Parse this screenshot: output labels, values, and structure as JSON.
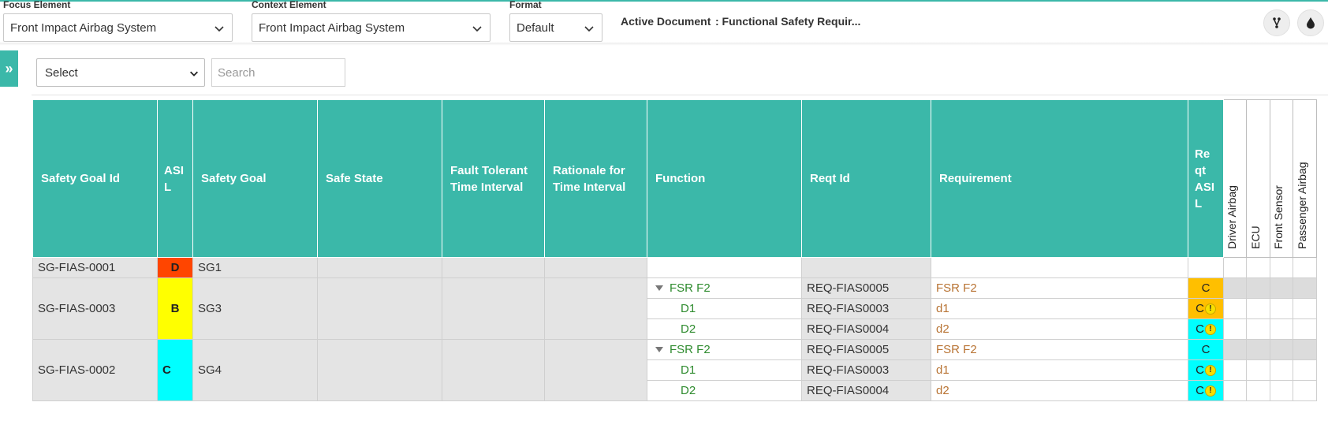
{
  "header": {
    "focus_label": "Focus Element",
    "focus_value": "Front Impact Airbag System",
    "context_label": "Context Element",
    "context_value": "Front Impact Airbag System",
    "format_label": "Format",
    "format_value": "Default",
    "active_doc_label": "Active Document",
    "active_doc_value": ": Functional Safety Requir..."
  },
  "toolbar": {
    "filter_select_value": "Select",
    "search_placeholder": "Search",
    "sidebar_toggle_glyph": "»"
  },
  "icons": {
    "left_button": "branch-icon",
    "right_button": "drop-icon",
    "sidebar_toggle": "double-chevron-right-icon",
    "row_expand": "triangle-down-icon",
    "warning": "warning-icon"
  },
  "colors": {
    "accent": "#3bb8a9",
    "asil_D": "#ff4500",
    "asil_B": "#ffff00",
    "asil_C": "#00ffff",
    "reqt_asil_orange": "#ffbf00",
    "function_text": "#2e8b2e",
    "requirement_text": "#b87333"
  },
  "table": {
    "columns": {
      "safety_goal_id": "Safety Goal Id",
      "asil": "ASI L",
      "safety_goal": "Safety Goal",
      "safe_state": "Safe State",
      "ftti": "Fault Tolerant Time Interval",
      "rationale": "Rationale for Time Interval",
      "function": "Function",
      "reqt_id": "Reqt Id",
      "requirement": "Requirement",
      "reqt_asil": "Re qt ASI L",
      "driver_airbag": "Driver Airbag",
      "ecu": "ECU",
      "front_sensor": "Front Sensor",
      "passenger_airbag": "Passenger Airbag"
    },
    "goals": [
      {
        "id": "SG-FIAS-0001",
        "asil": "D",
        "goal": "SG1"
      },
      {
        "id": "SG-FIAS-0003",
        "asil": "B",
        "goal": "SG3",
        "rows": [
          {
            "function": "FSR F2",
            "reqt_id": "REQ-FIAS0005",
            "requirement": "FSR F2",
            "reqt_asil": "C"
          },
          {
            "function": "D1",
            "reqt_id": "REQ-FIAS0003",
            "requirement": "d1",
            "reqt_asil": "C"
          },
          {
            "function": "D2",
            "reqt_id": "REQ-FIAS0004",
            "requirement": "d2",
            "reqt_asil": "C"
          }
        ]
      },
      {
        "id": "SG-FIAS-0002",
        "asil": "C",
        "goal": "SG4",
        "rows": [
          {
            "function": "FSR F2",
            "reqt_id": "REQ-FIAS0005",
            "requirement": "FSR F2",
            "reqt_asil": "C"
          },
          {
            "function": "D1",
            "reqt_id": "REQ-FIAS0003",
            "requirement": "d1",
            "reqt_asil": "C"
          },
          {
            "function": "D2",
            "reqt_id": "REQ-FIAS0004",
            "requirement": "d2",
            "reqt_asil": "C"
          }
        ]
      }
    ],
    "warning_glyph": "!"
  }
}
